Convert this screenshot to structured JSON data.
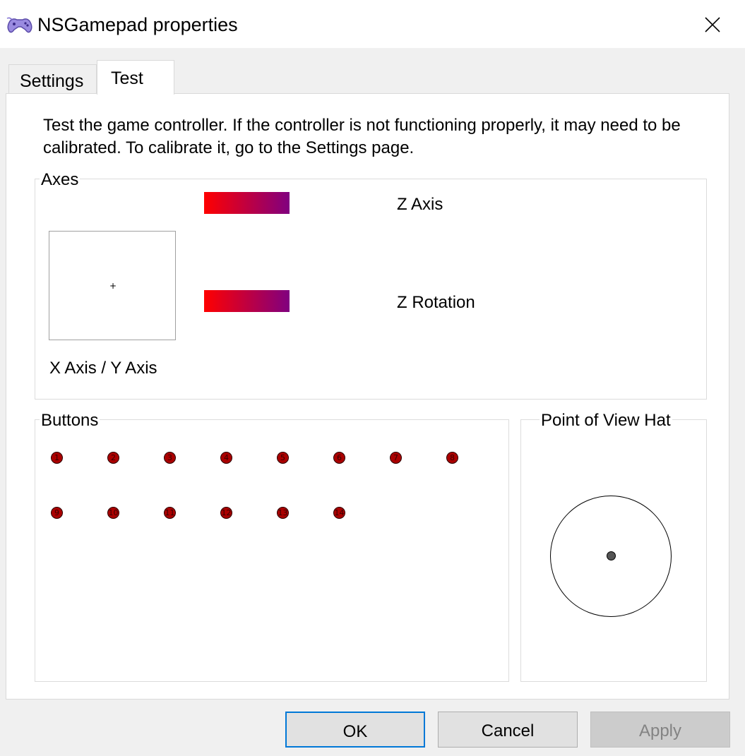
{
  "window": {
    "title": "NSGamepad properties",
    "icon": "gamepad-icon",
    "close_icon": "close-icon"
  },
  "tabs": [
    {
      "label": "Settings",
      "selected": false
    },
    {
      "label": "Test",
      "selected": true
    }
  ],
  "test_page": {
    "description": "Test the game controller.  If the controller is not functioning properly, it may need to be calibrated.  To calibrate it, go to the Settings page.",
    "axes": {
      "group_label": "Axes",
      "xy_label": "X Axis / Y Axis",
      "xy_marker": "+",
      "z_axis_label": "Z Axis",
      "z_rotation_label": "Z Rotation",
      "bar_colors": [
        "#ff0000",
        "#800080"
      ]
    },
    "buttons": {
      "group_label": "Buttons",
      "items": [
        "1",
        "2",
        "3",
        "4",
        "5",
        "6",
        "7",
        "8",
        "9",
        "10",
        "11",
        "12",
        "13",
        "14"
      ],
      "color": "#aa0000"
    },
    "pov_hat": {
      "group_label": "Point of View Hat"
    }
  },
  "footer": {
    "ok_label": "OK",
    "cancel_label": "Cancel",
    "apply_label": "Apply",
    "apply_enabled": false
  }
}
